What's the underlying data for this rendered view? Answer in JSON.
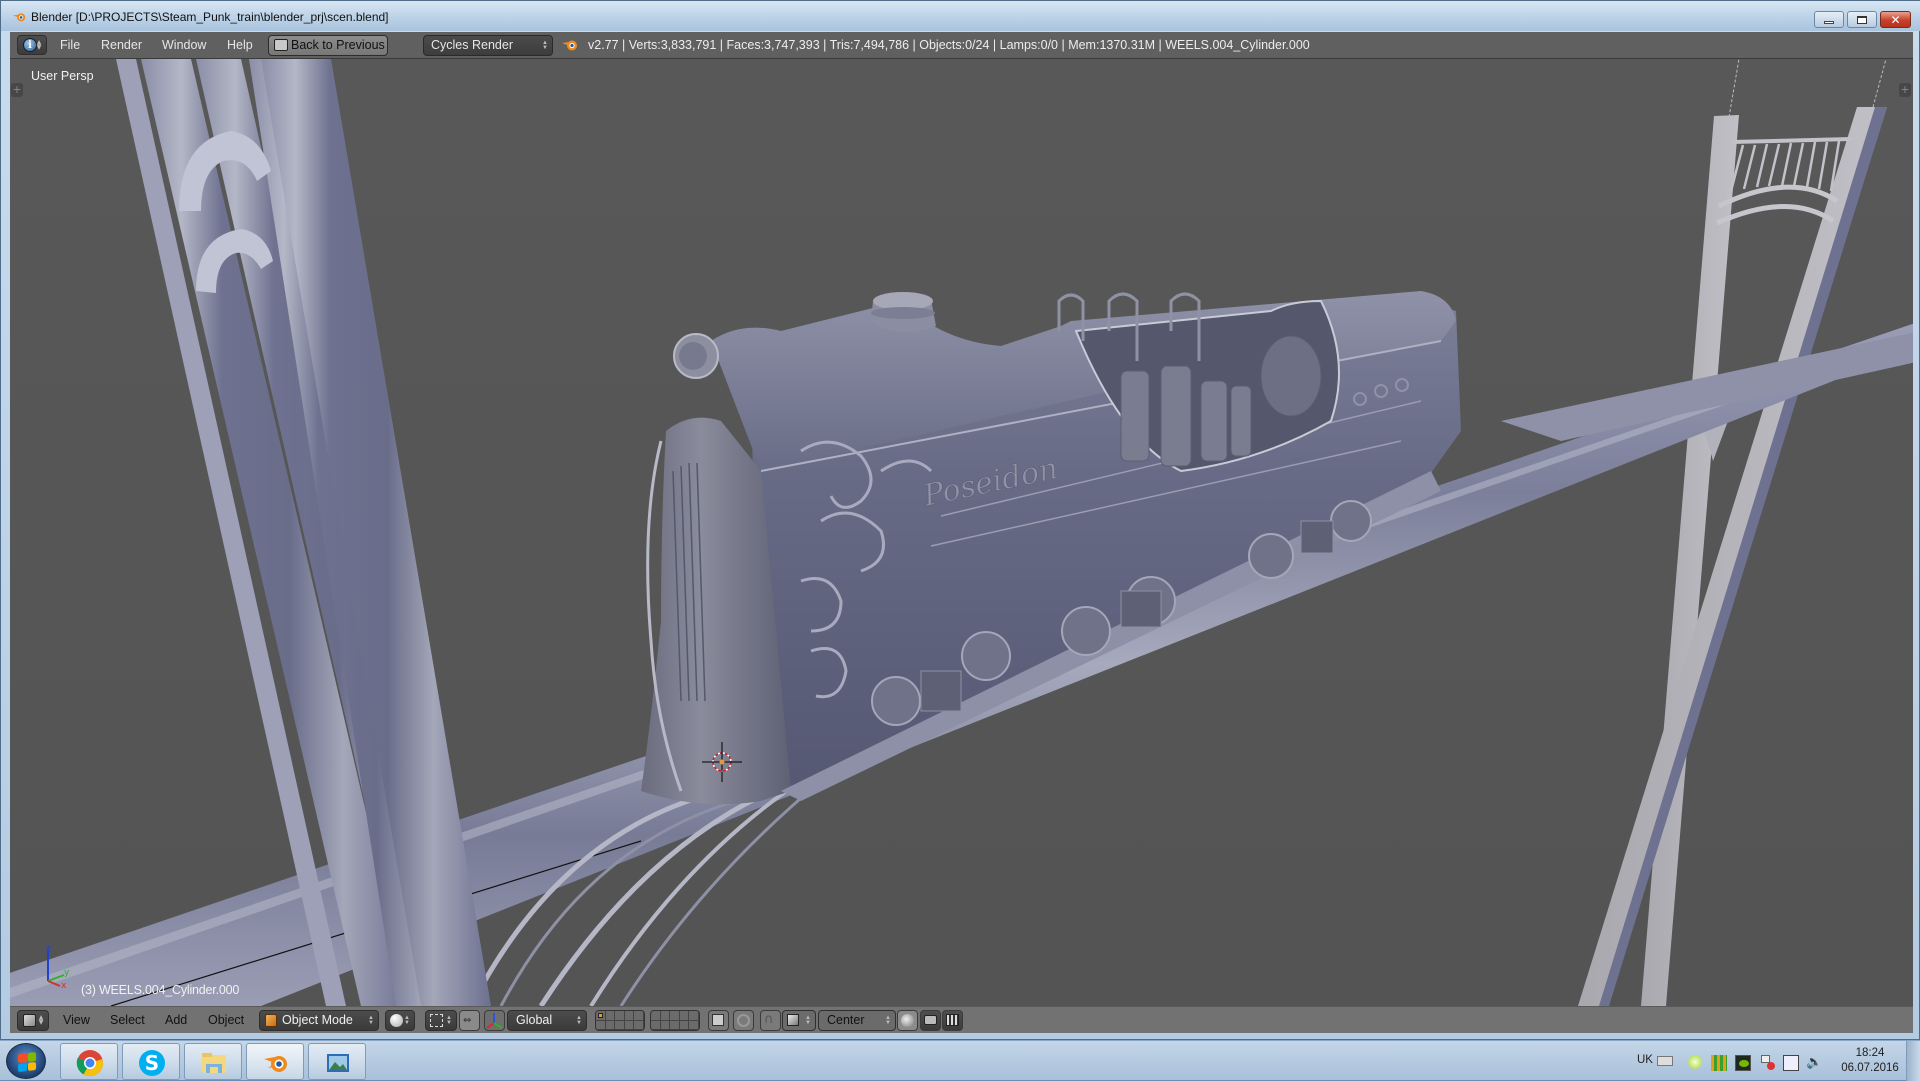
{
  "window": {
    "title": "Blender [D:\\PROJECTS\\Steam_Punk_train\\blender_prj\\scen.blend]",
    "controls": {
      "minimize": "minimize",
      "maximize": "maximize",
      "close": "close"
    }
  },
  "info_header": {
    "editor_type_icon": "info-icon",
    "menus": [
      "File",
      "Render",
      "Window",
      "Help"
    ],
    "back_button": "Back to Previous",
    "render_engine": "Cycles Render",
    "stats": "v2.77 | Verts:3,833,791 | Faces:3,747,393 | Tris:7,494,786 | Objects:0/24 | Lamps:0/0 | Mem:1370.31M | WEELS.004_Cylinder.000"
  },
  "viewport": {
    "view_label": "User Persp",
    "object_info": "(3) WEELS.004_Cylinder.000",
    "axes": {
      "x": "x",
      "y": "y",
      "z": "z"
    },
    "colors": {
      "background": "#555555",
      "model": "#6a6e8a",
      "model_highlight": "#b9bcd0",
      "axis_x": "#d03030",
      "axis_y": "#30b030",
      "axis_z": "#2040d0"
    }
  },
  "view_header": {
    "editor_type_icon": "3d-view-icon",
    "menus": [
      "View",
      "Select",
      "Add",
      "Object"
    ],
    "mode": "Object Mode",
    "shading": "solid-shading-icon",
    "orientation": "Global",
    "pivot": "Center"
  },
  "taskbar": {
    "apps": [
      {
        "name": "Google Chrome",
        "icon": "chrome-icon"
      },
      {
        "name": "Skype",
        "icon": "skype-icon"
      },
      {
        "name": "Windows Explorer",
        "icon": "folder-icon"
      },
      {
        "name": "Blender",
        "icon": "blender-icon",
        "active": true
      },
      {
        "name": "Photo Viewer",
        "icon": "image-viewer-icon"
      }
    ],
    "language": "UK",
    "time": "18:24",
    "date": "06.07.2016"
  }
}
